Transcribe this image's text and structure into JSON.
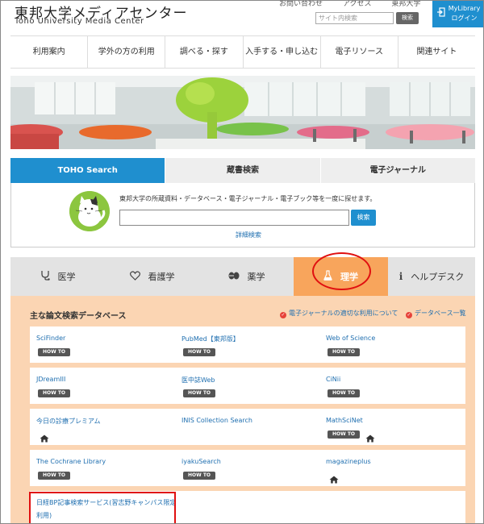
{
  "header": {
    "logo_jp": "東邦大学メディアセンター",
    "logo_en": "Toho University Media Center",
    "top_links": [
      "お問い合わせ",
      "アクセス",
      "東邦大学"
    ],
    "site_search_placeholder": "サイト内検索",
    "site_search_button": "検索",
    "mylibrary_line1": "MyLibrary",
    "mylibrary_line2": "ログイン"
  },
  "nav": {
    "items": [
      "利用案内",
      "学外の方の利用",
      "調べる・探す",
      "入手する・申し込む",
      "電子リソース",
      "関連サイト"
    ]
  },
  "search": {
    "tabs": [
      "TOHO Search",
      "蔵書検索",
      "電子ジャーナル"
    ],
    "active_tab": "TOHO Search",
    "description": "東邦大学の所蔵資料・データベース・電子ジャーナル・電子ブック等を一度に探せます。",
    "input_value": "",
    "button": "検索",
    "advanced_link": "詳細検索"
  },
  "subjects": {
    "tabs": [
      {
        "icon": "stethoscope-icon",
        "label": "医学"
      },
      {
        "icon": "heart-icon",
        "label": "看護学"
      },
      {
        "icon": "pills-icon",
        "label": "薬学"
      },
      {
        "icon": "flask-icon",
        "label": "理学"
      },
      {
        "icon": "info-icon",
        "label": "ヘルプデスク"
      }
    ],
    "active": "理学"
  },
  "databases": {
    "title": "主な論文検索データベース",
    "link_fair_use": "電子ジャーナルの適切な利用について",
    "link_db_list": "データベース一覧",
    "howto_label": "HOW TO",
    "rows": [
      [
        {
          "name": "SciFinder",
          "howto": true,
          "home": false
        },
        {
          "name": "PubMed【東邦版】",
          "howto": true,
          "home": false
        },
        {
          "name": "Web of Science",
          "howto": true,
          "home": false
        }
      ],
      [
        {
          "name": "JDreamIII",
          "howto": true,
          "home": false
        },
        {
          "name": "医中誌Web",
          "howto": true,
          "home": false
        },
        {
          "name": "CiNii",
          "howto": true,
          "home": false
        }
      ],
      [
        {
          "name": "今日の診療プレミアム",
          "howto": false,
          "home": true
        },
        {
          "name": "INIS Collection Search",
          "howto": false,
          "home": false
        },
        {
          "name": "MathSciNet",
          "howto": true,
          "home": true
        }
      ],
      [
        {
          "name": "The Cochrane Library",
          "howto": true,
          "home": false
        },
        {
          "name": "iyakuSearch",
          "howto": true,
          "home": false
        },
        {
          "name": "magazineplus",
          "howto": false,
          "home": true
        }
      ]
    ],
    "last_row_name_line1": "日経BP記事検索サービス(習志野キャンパス限定",
    "last_row_name_line2": "利用)"
  },
  "colors": {
    "accent_blue": "#1f8fcf",
    "subject_active_orange": "#f8a55c",
    "panel_peach": "#fbd5b3",
    "highlight_red": "#e01010"
  }
}
